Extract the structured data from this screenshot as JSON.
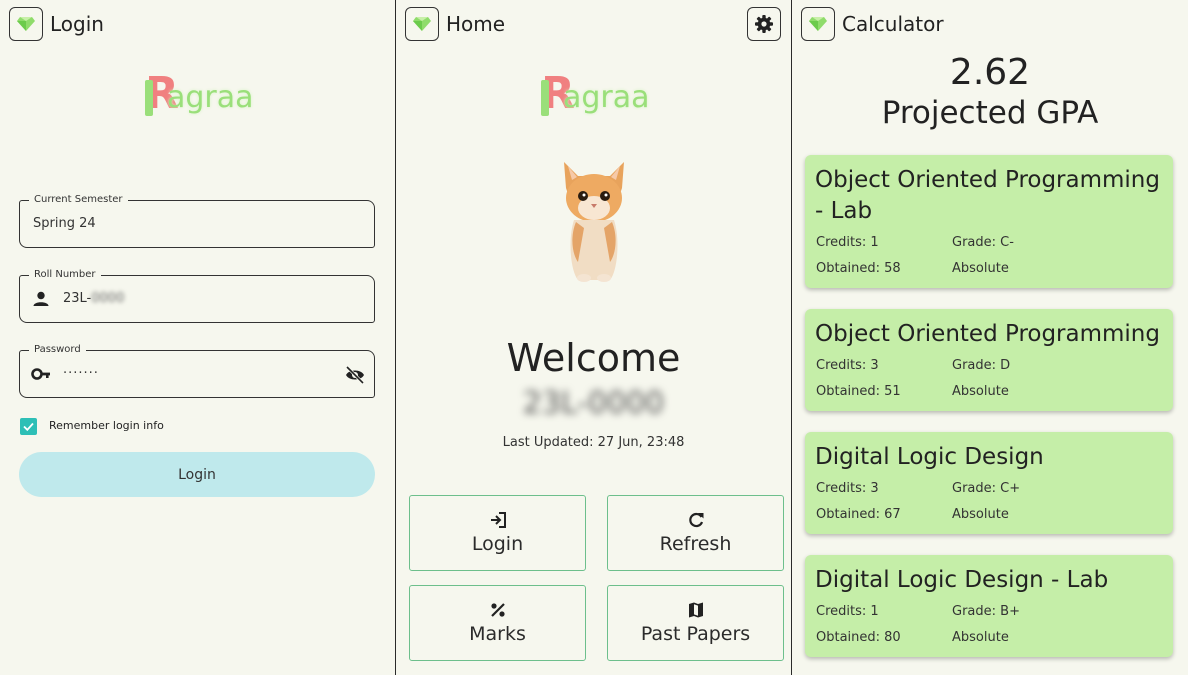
{
  "login_panel": {
    "title": "Login",
    "logo_text": "agraa",
    "semester": {
      "label": "Current Semester",
      "value": "Spring 24"
    },
    "roll": {
      "label": "Roll Number",
      "value": "23L-",
      "blurred": "0000"
    },
    "password": {
      "label": "Password",
      "value": "·······"
    },
    "remember": {
      "label": "Remember login info",
      "checked": true
    },
    "login_button": "Login"
  },
  "home_panel": {
    "title": "Home",
    "logo_text": "agraa",
    "welcome": "Welcome",
    "name_blurred": "23L-0000",
    "last_updated": "Last Updated: 27 Jun, 23:48",
    "tiles": [
      {
        "label": "Login",
        "icon": "login-icon"
      },
      {
        "label": "Refresh",
        "icon": "refresh-icon"
      },
      {
        "label": "Marks",
        "icon": "percent-icon"
      },
      {
        "label": "Past Papers",
        "icon": "map-icon"
      }
    ]
  },
  "calculator_panel": {
    "title": "Calculator",
    "gpa": "2.62",
    "gpa_label": "Projected GPA",
    "courses": [
      {
        "name": "Object Oriented Programming - Lab",
        "credits": "Credits: 1",
        "grade": "Grade: C-",
        "obtained": "Obtained: 58",
        "type": "Absolute"
      },
      {
        "name": "Object Oriented Programming",
        "credits": "Credits: 3",
        "grade": "Grade: D",
        "obtained": "Obtained: 51",
        "type": "Absolute"
      },
      {
        "name": "Digital Logic Design",
        "credits": "Credits: 3",
        "grade": "Grade: C+",
        "obtained": "Obtained: 67",
        "type": "Absolute"
      },
      {
        "name": "Digital Logic Design - Lab",
        "credits": "Credits: 1",
        "grade": "Grade: B+",
        "obtained": "Obtained: 80",
        "type": "Absolute"
      }
    ]
  },
  "colors": {
    "background": "#f6f7ee",
    "accent_teal": "#2dbfb6",
    "login_button": "#bfe9ec",
    "course_card": "#c5eea8",
    "tile_border": "#6dbf8c",
    "logo_red": "#f08080",
    "logo_green": "#9adf7a"
  }
}
